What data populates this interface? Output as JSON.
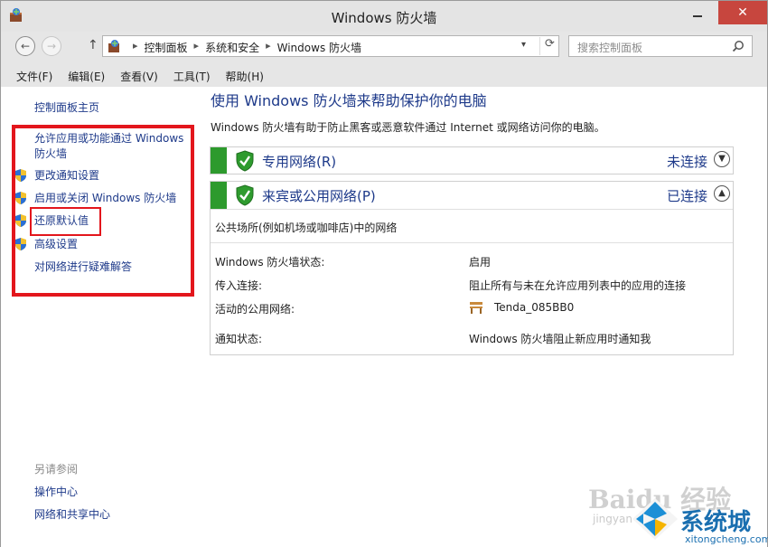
{
  "window": {
    "title": "Windows 防火墙",
    "minimize_label": "–",
    "close_label": "✕"
  },
  "address": {
    "crumbs": [
      "控制面板",
      "系统和安全",
      "Windows 防火墙"
    ],
    "search_placeholder": "搜索控制面板"
  },
  "menu": [
    "文件(F)",
    "编辑(E)",
    "查看(V)",
    "工具(T)",
    "帮助(H)"
  ],
  "sidebar": {
    "home": "控制面板主页",
    "items": [
      {
        "label": "允许应用或功能通过 Windows 防火墙",
        "icon": "none"
      },
      {
        "label": "更改通知设置",
        "icon": "uac-shield-icon"
      },
      {
        "label": "启用或关闭 Windows 防火墙",
        "icon": "uac-shield-icon"
      },
      {
        "label": "还原默认值",
        "icon": "uac-shield-icon"
      },
      {
        "label": "高级设置",
        "icon": "uac-shield-icon"
      },
      {
        "label": "对网络进行疑难解答",
        "icon": "none"
      }
    ],
    "see_also": "另请参阅",
    "see_also_links": [
      "操作中心",
      "网络和共享中心"
    ]
  },
  "main": {
    "title": "使用 Windows 防火墙来帮助保护你的电脑",
    "description": "Windows 防火墙有助于防止黑客或恶意软件通过 Internet 或网络访问你的电脑。",
    "private_network": {
      "name": "专用网络(R)",
      "status": "未连接"
    },
    "public_network": {
      "name": "来宾或公用网络(P)",
      "status": "已连接",
      "subtitle": "公共场所(例如机场或咖啡店)中的网络",
      "rows": [
        {
          "key": "Windows 防火墙状态:",
          "value": "启用"
        },
        {
          "key": "传入连接:",
          "value": "阻止所有与未在允许应用列表中的应用的连接"
        },
        {
          "key": "活动的公用网络:",
          "value": "Tenda_085BB0"
        },
        {
          "key": "通知状态:",
          "value": "Windows 防火墙阻止新应用时通知我"
        }
      ]
    }
  },
  "watermark": {
    "baidu": "Baidu 经验",
    "baidu_sub": "jingyan",
    "site_name": "系统城",
    "site_url": "xitongcheng.com"
  },
  "colors": {
    "link": "#1e3a8a",
    "green_tab": "#2d9a2d",
    "close_btn": "#c7463e",
    "highlight": "#e3161c"
  }
}
